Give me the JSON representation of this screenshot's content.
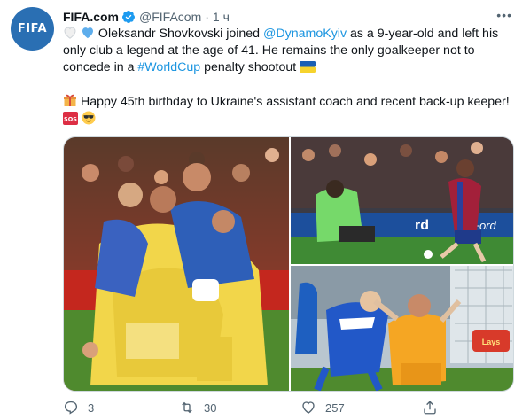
{
  "account": {
    "avatar_text": "FIFA",
    "name": "FIFA.com",
    "handle": "@FIFAcom",
    "separator": "·",
    "time": "1 ч",
    "verified_color": "#1d9bf0"
  },
  "tweet": {
    "line1_prefix": "Oleksandr Shovkovski joined ",
    "mention": "@DynamoKyiv",
    "line1_suffix": " as a 9-year-old and left his only club a legend at the age of 41. He remains the only goalkeeper not to concede in a ",
    "hashtag": "#WorldCup",
    "line1_end": " penalty shootout ",
    "line2": " Happy 45th birthday to Ukraine's assistant coach and recent back-up keeper! ",
    "emojis": [
      "white-heart",
      "blue-heart",
      "ukraine-flag",
      "gift",
      "sos",
      "face-with-sunglasses"
    ]
  },
  "actions": {
    "reply_count": "3",
    "retweet_count": "30",
    "like_count": "257"
  },
  "colors": {
    "link": "#1b95e0",
    "secondary_text": "#536471",
    "avatar_bg": "#2a6fb3"
  }
}
